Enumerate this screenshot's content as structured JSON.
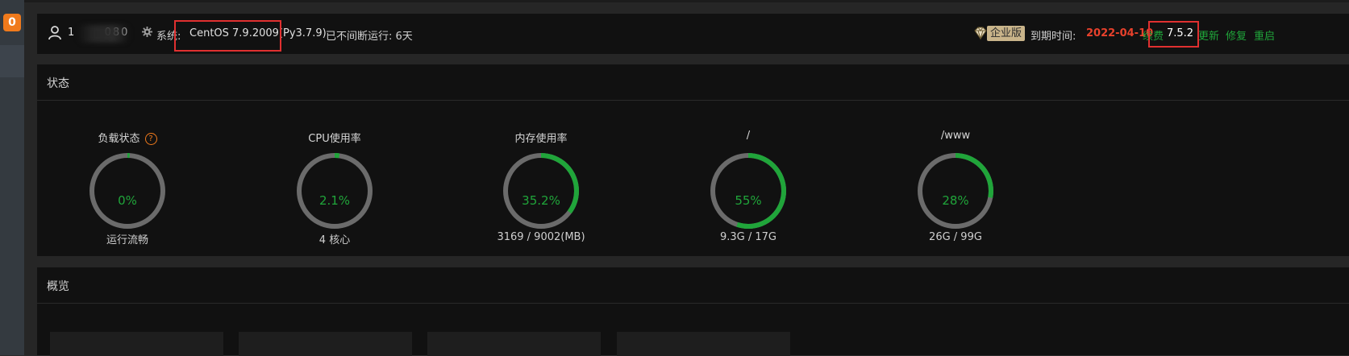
{
  "sidebar": {
    "badge": "0"
  },
  "header": {
    "username": "1        080",
    "system_label": "系统:",
    "system_value": "CentOS 7.9.2009(Py3.7.9)",
    "uptime": "已不间断运行: 6天",
    "edition": "企业版",
    "expire_label": "到期时间:",
    "expire_date": "2022-04-10",
    "renew": "续费",
    "version": "7.5.2",
    "update": "更新",
    "repair": "修复",
    "restart": "重启"
  },
  "status": {
    "title": "状态",
    "gauges": [
      {
        "title": "负载状态",
        "value": "0%",
        "percent": 1,
        "sub": "运行流畅",
        "has_help": true
      },
      {
        "title": "CPU使用率",
        "value": "2.1%",
        "percent": 2.1,
        "sub": "4 核心"
      },
      {
        "title": "内存使用率",
        "value": "35.2%",
        "percent": 35.2,
        "sub": "3169 / 9002(MB)"
      },
      {
        "title": "/",
        "value": "55%",
        "percent": 55,
        "sub": "9.3G / 17G"
      },
      {
        "title": "/www",
        "value": "28%",
        "percent": 28,
        "sub": "26G / 99G"
      }
    ]
  },
  "overview": {
    "title": "概览"
  },
  "colors": {
    "accent_green": "#20a53a",
    "expire_red": "#e8412c",
    "badge_orange": "#f07a1c",
    "ring_track": "#6b6b6b"
  }
}
